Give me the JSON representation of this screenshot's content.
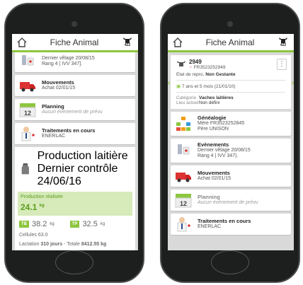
{
  "colors": {
    "accent": "#8dc63f",
    "production_bg": "#d6ebb9",
    "production_text": "#5c9c1e"
  },
  "header": {
    "title": "Fiche Animal",
    "badge": "422"
  },
  "left": {
    "evenements": {
      "line1": "Dernier vêlage 20/08/15",
      "line2": "Rang 4 | IVV 347]."
    },
    "mouvements": {
      "title": "Mouvements",
      "detail": "Achat 02/01/15"
    },
    "planning": {
      "title": "Planning",
      "detail": "Aucun événement de prévu",
      "calendar_day": "12"
    },
    "traitements": {
      "title": "Traitements en cours",
      "detail": "ENERLAC"
    },
    "production": {
      "title": "Production laitière",
      "detail": "Dernier contrôle 24/06/16",
      "realisee_label": "Production réalisée",
      "realisee_value": "24.1",
      "realisee_unit": "kg",
      "tb_label": "TB",
      "tb_value": "38.2",
      "tb_unit": "kg",
      "tp_label": "TP",
      "tp_value": "32.5",
      "tp_unit": "kg",
      "cellules": "Cellules 63.0",
      "lactation_prefix": "Lactation ",
      "lactation_days": "310 jours",
      "lactation_mid": " - Totale ",
      "lactation_total": "8412.55 kg"
    }
  },
  "right": {
    "animal": {
      "number": "2949",
      "id": "FR3523252949",
      "etat_label": "Etat de repro. ",
      "etat_value": "Non Gestante",
      "age": "7 ans et 5 mois (21/01/10)",
      "categorie_label": "Catégorie",
      "categorie_value": "Vaches laitières",
      "lieu_label": "Lieu actuel",
      "lieu_value": "Non défini",
      "menu": "⋮"
    },
    "genealogie": {
      "title": "Généalogie",
      "mere": "Mère FR3523252845",
      "pere": "Père UNISON"
    },
    "evenements": {
      "title": "Evènements",
      "line1": "Dernier vêlage 20/08/15",
      "line2": "Rang 4 | IVV 347)."
    },
    "mouvements": {
      "title": "Mouvements",
      "detail": "Achat 02/01/15"
    },
    "planning": {
      "title": "Planning",
      "detail": "Aucun évènement de prévu",
      "calendar_day": "12"
    },
    "traitements": {
      "title": "Traitements en cours",
      "detail": "ENERLAC"
    }
  }
}
